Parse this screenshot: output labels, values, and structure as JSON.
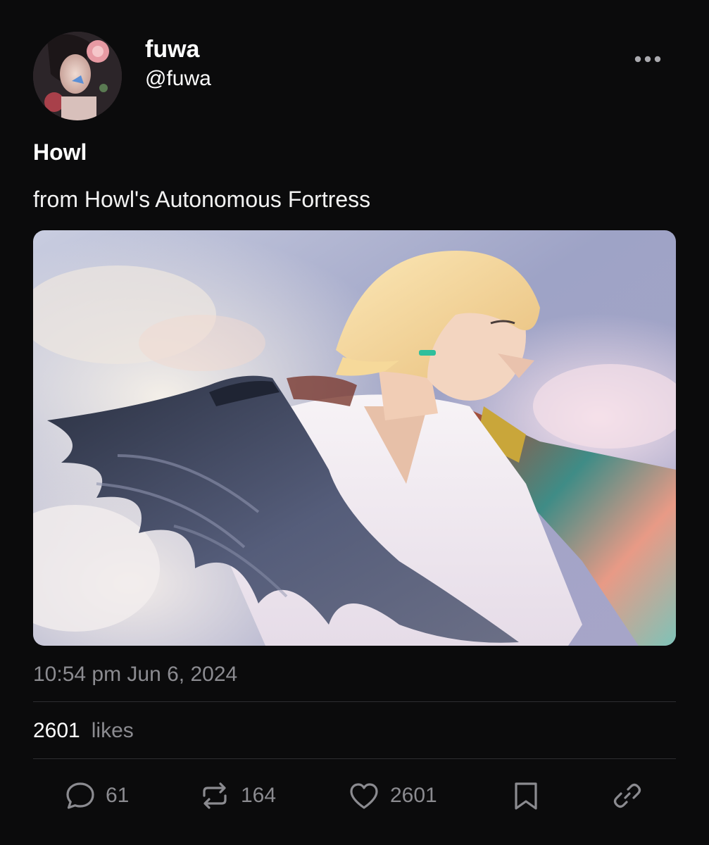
{
  "author": {
    "display_name": "fuwa",
    "handle": "@fuwa"
  },
  "post": {
    "title": "Howl",
    "body": "from Howl's Autonomous Fortress",
    "timestamp": "10:54 pm Jun 6, 2024",
    "likes_count": "2601",
    "likes_label": "likes"
  },
  "actions": {
    "replies": "61",
    "reposts": "164",
    "likes": "2601"
  },
  "icons": {
    "more": "more-horizontal-icon",
    "reply": "speech-bubble-icon",
    "repost": "repost-arrows-icon",
    "like": "heart-icon",
    "bookmark": "bookmark-icon",
    "share": "link-icon"
  },
  "colors": {
    "background": "#0b0b0c",
    "text": "#ffffff",
    "muted": "#8b8b90",
    "divider": "#2e2e31"
  }
}
